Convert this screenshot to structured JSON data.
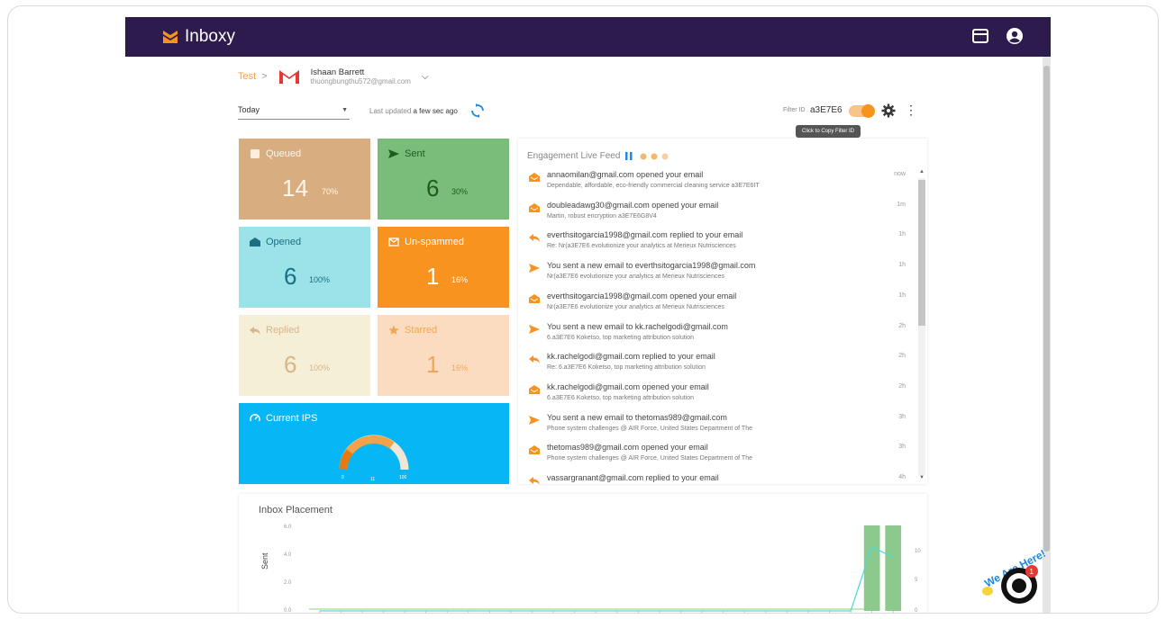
{
  "app": {
    "name": "Inboxy"
  },
  "breadcrumb": {
    "link": "Test",
    "sep": ">",
    "account_name": "Ishaan Barrett",
    "account_email": "thuongbungthu572@gmail.com"
  },
  "filters": {
    "date_range": "Today",
    "last_updated_label": "Last updated",
    "last_updated_value": "a few sec ago",
    "filter_id_label": "Filter ID",
    "filter_id_value": "a3E7E6",
    "tooltip": "Click to Copy Filter ID"
  },
  "stats": {
    "queued": {
      "label": "Queued",
      "value": "14",
      "pct": "70%"
    },
    "sent": {
      "label": "Sent",
      "value": "6",
      "pct": "30%"
    },
    "opened": {
      "label": "Opened",
      "value": "6",
      "pct": "100%"
    },
    "unspammed": {
      "label": "Un-spammed",
      "value": "1",
      "pct": "16%"
    },
    "replied": {
      "label": "Replied",
      "value": "6",
      "pct": "100%"
    },
    "starred": {
      "label": "Starred",
      "value": "1",
      "pct": "16%"
    },
    "ips": {
      "label": "Current IPS",
      "gauge_min": "0",
      "gauge_mid": "11",
      "gauge_max": "100"
    }
  },
  "feed": {
    "title": "Engagement Live Feed",
    "items": [
      {
        "type": "opened",
        "t1": "annaomilan@gmail.com opened your email",
        "t2": "Dependable, affordable, eco-friendly commercial cleaning service a3E7E6IT",
        "time": "now"
      },
      {
        "type": "opened",
        "t1": "doubleadawg30@gmail.com opened your email",
        "t2": "Martin, robust encryption a3E7E6G8V4",
        "time": "1m"
      },
      {
        "type": "replied",
        "t1": "everthsitogarcia1998@gmail.com replied to your email",
        "t2": "Re: Nr(a3E7E6 evolutionize your analytics at Merieux Nutrisciences",
        "time": "1h"
      },
      {
        "type": "sent",
        "t1": "You sent a new email to everthsitogarcia1998@gmail.com",
        "t2": "Nr(a3E7E6 evolutionize your analytics at Merieux Nutrisciences",
        "time": "1h"
      },
      {
        "type": "opened",
        "t1": "everthsitogarcia1998@gmail.com opened your email",
        "t2": "Nr(a3E7E6 evolutionize your analytics at Merieux Nutrisciences",
        "time": "1h"
      },
      {
        "type": "sent",
        "t1": "You sent a new email to kk.rachelgodi@gmail.com",
        "t2": "6.a3E7E6 Koketso, top marketing attribution solution",
        "time": "2h"
      },
      {
        "type": "replied",
        "t1": "kk.rachelgodi@gmail.com replied to your email",
        "t2": "Re: 6.a3E7E6 Koketso, top marketing attribution solution",
        "time": "2h"
      },
      {
        "type": "opened",
        "t1": "kk.rachelgodi@gmail.com opened your email",
        "t2": "6.a3E7E6 Koketso, top marketing attribution solution",
        "time": "2h"
      },
      {
        "type": "sent",
        "t1": "You sent a new email to thetomas989@gmail.com",
        "t2": "Phone system challenges @ AIR Force, United States Department of The",
        "time": "3h"
      },
      {
        "type": "opened",
        "t1": "thetomas989@gmail.com opened your email",
        "t2": "Phone system challenges @ AIR Force, United States Department of The",
        "time": "3h"
      },
      {
        "type": "replied",
        "t1": "vassargranant@gmail.com replied to your email",
        "t2": "",
        "time": "4h"
      }
    ]
  },
  "chart_data": {
    "type": "bar",
    "title": "Inbox Placement",
    "ylabel": "Sent",
    "ylim": [
      0,
      6
    ],
    "yticks": [
      "6.0",
      "4.0",
      "2.0",
      "0.0"
    ],
    "y2ticks": [
      "10",
      "5",
      "0"
    ],
    "n_categories": 28,
    "series": [
      {
        "values": [
          0,
          0,
          0,
          0,
          0,
          0,
          0,
          0,
          0,
          0,
          0,
          0,
          0,
          0,
          0,
          0,
          0,
          0,
          0,
          0,
          0,
          0,
          0,
          0,
          0,
          0,
          6,
          6
        ]
      }
    ],
    "line": [
      0,
      0,
      0,
      0,
      0,
      0,
      0,
      0,
      0,
      0,
      0,
      0,
      0,
      0,
      0,
      0,
      0,
      0,
      0,
      0,
      0,
      0,
      0,
      0,
      0,
      0,
      6,
      5
    ],
    "colors": {
      "bars": "#8cc98c",
      "line": "#4dd9d9",
      "baseline": "#b8e0a8"
    }
  },
  "chat": {
    "badge": "1",
    "label": "We Are Here!"
  }
}
